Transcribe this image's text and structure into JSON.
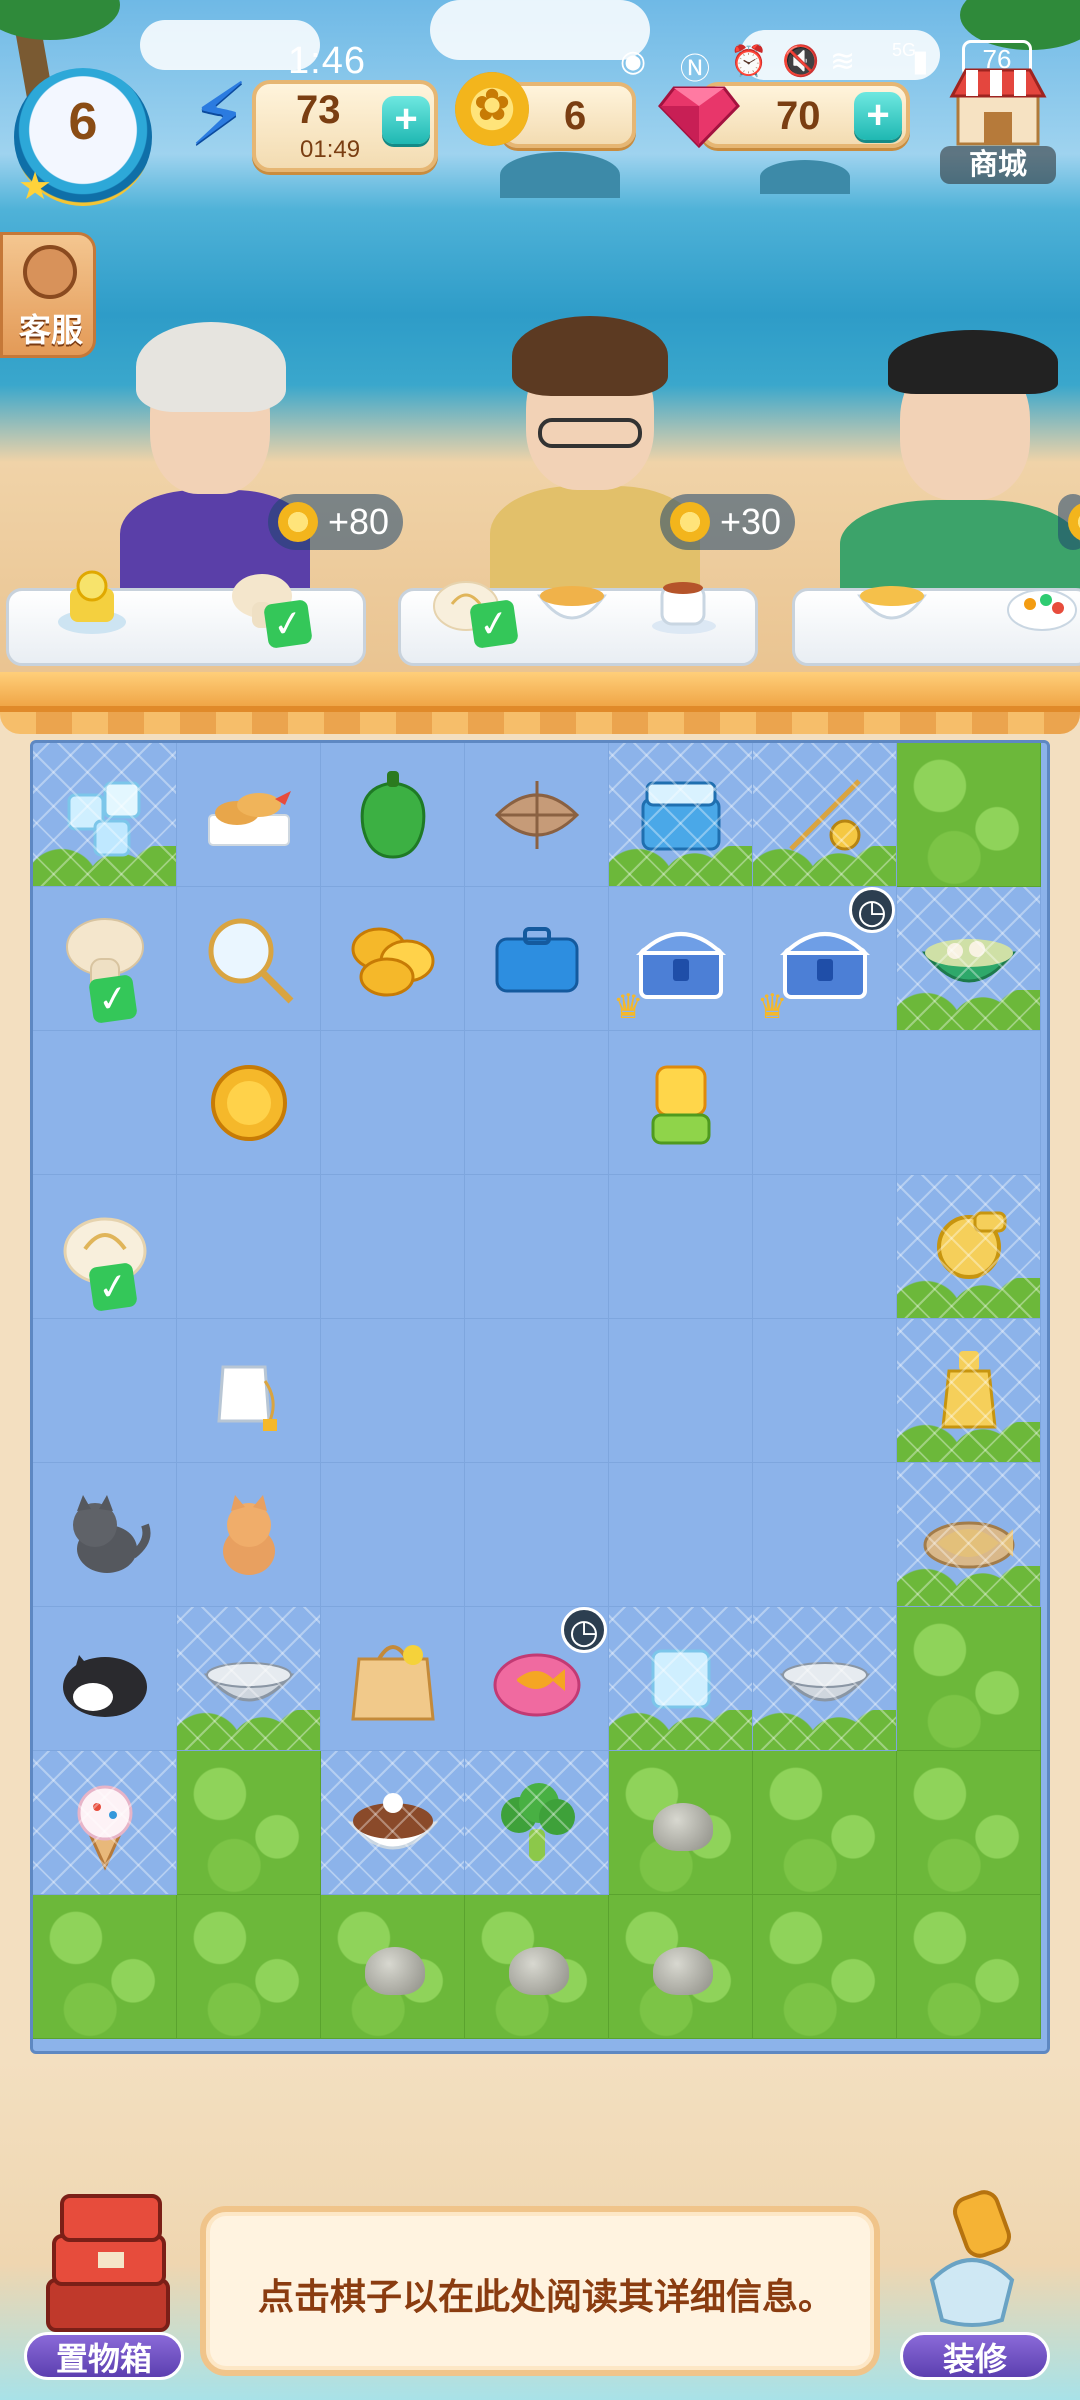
{
  "status_bar": {
    "time": "1:46",
    "network": "5G",
    "battery": "76"
  },
  "hud": {
    "level": "6",
    "energy": {
      "value": "73",
      "timer": "01:49"
    },
    "coins": {
      "value": "6"
    },
    "gems": {
      "value": "70"
    },
    "plus_label": "+",
    "shop_label": "商城",
    "service_label": "客服"
  },
  "customers": [
    {
      "reward": "+80",
      "order": [
        "lemon-cake",
        "mushroom"
      ],
      "order_done": [
        false,
        true
      ]
    },
    {
      "reward": "+30",
      "order": [
        "steamed-bun",
        "soup-bowl",
        "tea-cup"
      ],
      "order_done": [
        true,
        false,
        false
      ]
    },
    {
      "reward": "",
      "order": [
        "soup-bowl",
        "fried-rice"
      ],
      "order_done": [
        false,
        false
      ]
    }
  ],
  "board": {
    "columns": 7,
    "rows": 9,
    "items": [
      {
        "r": 0,
        "c": 0,
        "name": "ice-cubes",
        "web": true,
        "bush": true
      },
      {
        "r": 0,
        "c": 1,
        "name": "fried-shrimp"
      },
      {
        "r": 0,
        "c": 2,
        "name": "green-pepper"
      },
      {
        "r": 0,
        "c": 3,
        "name": "wrapped-package"
      },
      {
        "r": 0,
        "c": 4,
        "name": "ice-cooler",
        "web": true,
        "bush": true
      },
      {
        "r": 0,
        "c": 5,
        "name": "fishing-rod",
        "web": true,
        "bush": true
      },
      {
        "r": 0,
        "c": 6,
        "name": "grass"
      },
      {
        "r": 1,
        "c": 0,
        "name": "mushroom",
        "check": true
      },
      {
        "r": 1,
        "c": 1,
        "name": "fishing-net"
      },
      {
        "r": 1,
        "c": 2,
        "name": "coin-pile"
      },
      {
        "r": 1,
        "c": 3,
        "name": "blue-toolbox"
      },
      {
        "r": 1,
        "c": 4,
        "name": "treasure-chest",
        "crown": true
      },
      {
        "r": 1,
        "c": 5,
        "name": "treasure-chest",
        "crown": true,
        "timer": true
      },
      {
        "r": 1,
        "c": 6,
        "name": "dumpling-soup",
        "web": true,
        "bush": true
      },
      {
        "r": 2,
        "c": 1,
        "name": "gold-coin"
      },
      {
        "r": 2,
        "c": 4,
        "name": "juicer"
      },
      {
        "r": 3,
        "c": 0,
        "name": "steamed-bun",
        "check": true
      },
      {
        "r": 3,
        "c": 6,
        "name": "golden-machine",
        "web": true,
        "bush": true
      },
      {
        "r": 4,
        "c": 1,
        "name": "tea-bag"
      },
      {
        "r": 4,
        "c": 6,
        "name": "golden-bottle",
        "web": true,
        "bush": true
      },
      {
        "r": 5,
        "c": 0,
        "name": "grey-cat"
      },
      {
        "r": 5,
        "c": 1,
        "name": "orange-cat"
      },
      {
        "r": 5,
        "c": 6,
        "name": "fish-dish",
        "web": true,
        "bush": true
      },
      {
        "r": 6,
        "c": 0,
        "name": "sleeping-cat"
      },
      {
        "r": 6,
        "c": 1,
        "name": "silver-bowl",
        "web": true,
        "bush": true
      },
      {
        "r": 6,
        "c": 2,
        "name": "gift-bag"
      },
      {
        "r": 6,
        "c": 3,
        "name": "fish-cushion",
        "timer": true
      },
      {
        "r": 6,
        "c": 4,
        "name": "ice-cube",
        "web": true,
        "bush": true
      },
      {
        "r": 6,
        "c": 5,
        "name": "silver-bowl",
        "web": true,
        "bush": true
      },
      {
        "r": 6,
        "c": 6,
        "name": "grass"
      },
      {
        "r": 7,
        "c": 0,
        "name": "ice-cream-cone",
        "web": true
      },
      {
        "r": 7,
        "c": 1,
        "name": "grass"
      },
      {
        "r": 7,
        "c": 2,
        "name": "dessert-bowl",
        "web": true
      },
      {
        "r": 7,
        "c": 3,
        "name": "broccoli",
        "web": true
      },
      {
        "r": 7,
        "c": 4,
        "name": "grass-rock"
      },
      {
        "r": 7,
        "c": 5,
        "name": "grass"
      },
      {
        "r": 7,
        "c": 6,
        "name": "grass"
      },
      {
        "r": 8,
        "c": 0,
        "name": "grass"
      },
      {
        "r": 8,
        "c": 1,
        "name": "grass"
      },
      {
        "r": 8,
        "c": 2,
        "name": "grass-rock"
      },
      {
        "r": 8,
        "c": 3,
        "name": "grass-rock"
      },
      {
        "r": 8,
        "c": 4,
        "name": "grass-rock"
      },
      {
        "r": 8,
        "c": 5,
        "name": "grass"
      },
      {
        "r": 8,
        "c": 6,
        "name": "grass"
      }
    ]
  },
  "bottom": {
    "storage_label": "置物箱",
    "decorate_label": "装修",
    "info_text": "点击棋子以在此处阅读其详细信息。"
  },
  "colors": {
    "board_blue": "#8cb3ea",
    "grass_green": "#6cb83a",
    "accent_teal": "#1fb8b2",
    "text_brown": "#8a3c10"
  }
}
